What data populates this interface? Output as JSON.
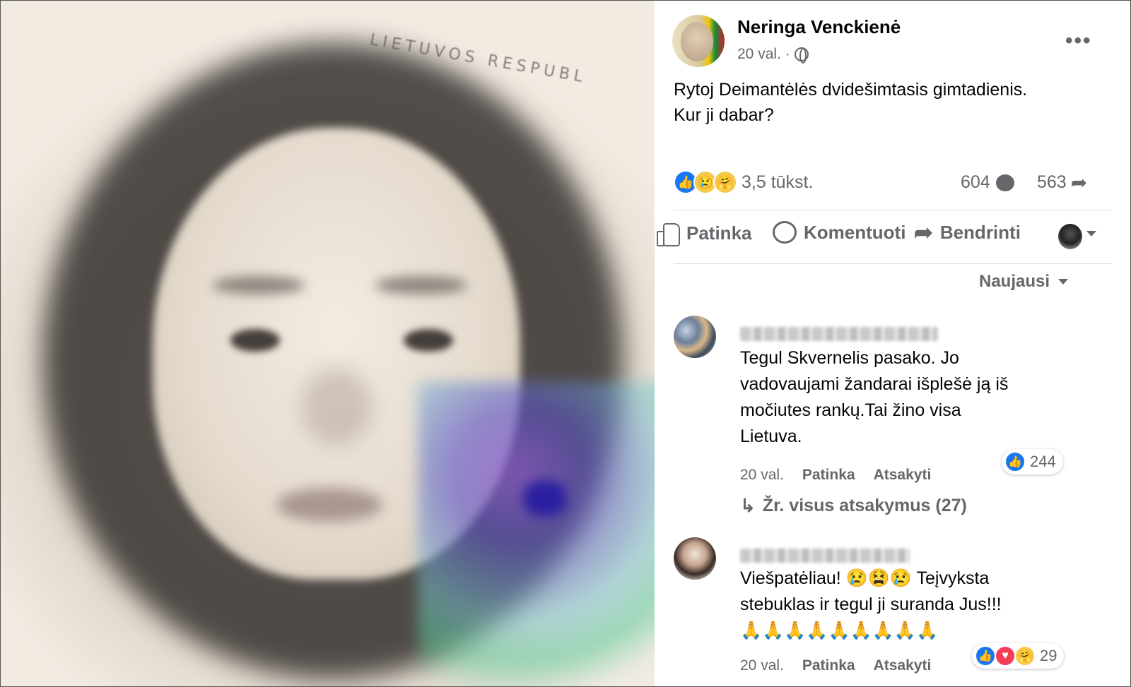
{
  "post": {
    "author": "Neringa Venckienė",
    "time": "20 val. ·",
    "text_line1": "Rytoj Deimantėlės dvidešimtasis gimtadienis.",
    "text_line2": "Kur ji dabar?",
    "reaction_count": "3,5 tūkst.",
    "comment_count": "604",
    "share_count": "563",
    "photo_stamp": "LIETUVOS RESPUBL"
  },
  "actions": {
    "like_label": "Patinka",
    "comment_label": "Komentuoti",
    "share_label": "Bendrinti"
  },
  "sort": {
    "label": "Naujausi"
  },
  "comments": [
    {
      "lines": [
        "Tegul Skvernelis pasako. Jo",
        "vadovaujami žandarai išplešė ją iš",
        "močiutes rankų.Tai žino visa",
        "Lietuva."
      ],
      "time": "20 val.",
      "like_label": "Patinka",
      "reply_label": "Atsakyti",
      "reaction_count": "244",
      "replies_label": "Žr. visus atsakymus (27)"
    },
    {
      "lines": [
        "Viešpatėliau! 😢😫😢 Teįvyksta",
        "stebuklas ir tegul ji suranda Jus!!!",
        "🙏🙏🙏🙏🙏🙏🙏🙏🙏"
      ],
      "time": "20 val.",
      "like_label": "Patinka",
      "reply_label": "Atsakyti",
      "reaction_count": "29"
    }
  ],
  "colors": {
    "accent": "#1877f2",
    "secondary_text": "#65676b",
    "love": "#f33e58",
    "sad": "#f7c94b"
  },
  "icons": [
    "globe-icon",
    "more-icon",
    "like-reaction-icon",
    "sad-reaction-icon",
    "care-reaction-icon",
    "comment-bubble-icon",
    "share-arrow-icon",
    "thumb-icon",
    "comment-icon",
    "share-icon",
    "caret-icon",
    "reply-arrow-icon"
  ]
}
